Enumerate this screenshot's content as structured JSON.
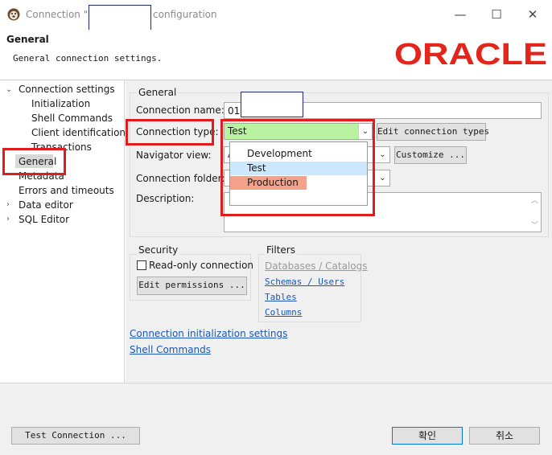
{
  "window": {
    "title_prefix": "Connection \"0",
    "title_suffix": "configuration",
    "minimize_glyph": "—",
    "maximize_glyph": "☐",
    "close_glyph": "✕"
  },
  "header": {
    "title": "General",
    "subtitle": "General connection settings.",
    "logo_text": "ORACLE",
    "logo_color": "#e3261b"
  },
  "tree": {
    "items": [
      {
        "label": "Connection settings",
        "expandable": "expanded"
      },
      {
        "label": "Initialization"
      },
      {
        "label": "Shell Commands"
      },
      {
        "label": "Client identification"
      },
      {
        "label": "Transactions"
      },
      {
        "label": "General",
        "selected": true
      },
      {
        "label": "Metadata"
      },
      {
        "label": "Errors and timeouts"
      },
      {
        "label": "Data editor",
        "expandable": "collapsed"
      },
      {
        "label": "SQL Editor",
        "expandable": "collapsed"
      }
    ]
  },
  "general": {
    "group_title": "General",
    "connection_name_label": "Connection name:",
    "connection_name_value": "01.",
    "connection_type_label": "Connection type:",
    "connection_type_value": "Test",
    "edit_types_button": "Edit connection types",
    "navigator_view_label": "Navigator view:",
    "navigator_view_value": "A",
    "customize_button": "Customize ...",
    "connection_folder_label": "Connection folder:",
    "description_label": "Description:"
  },
  "type_dropdown": {
    "options": [
      "Development",
      "Test",
      "Production"
    ],
    "highlighted": "Test",
    "production_color": "#f4a28a",
    "test_color": "#cce8ff"
  },
  "security": {
    "group_title": "Security",
    "read_only_label": "Read-only connection",
    "edit_permissions_button": "Edit permissions ..."
  },
  "filters": {
    "group_title": "Filters",
    "links": [
      {
        "label": "Databases / Catalogs",
        "enabled": false
      },
      {
        "label": "Schemas / Users",
        "enabled": true
      },
      {
        "label": "Tables",
        "enabled": true
      },
      {
        "label": "Columns",
        "enabled": true
      }
    ]
  },
  "links": {
    "init_settings": "Connection initialization settings",
    "shell_commands": "Shell Commands"
  },
  "footer": {
    "test_connection_button": "Test Connection ...",
    "ok_button": "확인",
    "cancel_button": "취소"
  },
  "colors": {
    "annotation_red": "#e01d1d",
    "test_type_green": "#b9f2a0",
    "link_blue": "#1a56b8"
  }
}
